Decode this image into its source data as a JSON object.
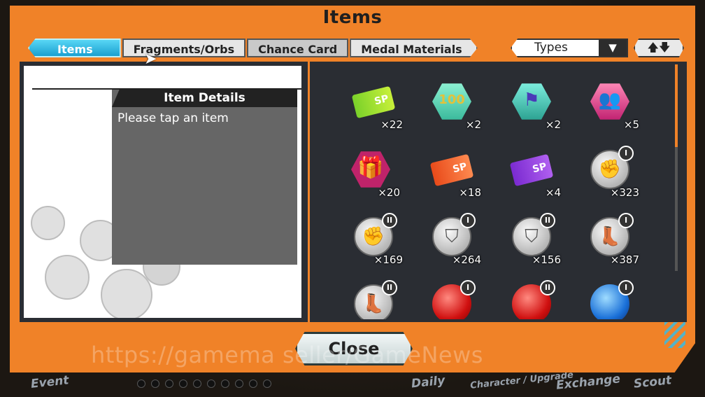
{
  "window": {
    "title": "Items"
  },
  "tabs": [
    {
      "label": "Items",
      "active": true
    },
    {
      "label": "Fragments/Orbs",
      "active": false
    },
    {
      "label": "Chance Card",
      "active": false
    },
    {
      "label": "Medal Materials",
      "active": false
    }
  ],
  "filter": {
    "types_label": "Types",
    "sort_icons": "🡅🡇"
  },
  "details": {
    "header": "Item Details",
    "placeholder": "Please tap an item"
  },
  "items": [
    {
      "icon": "sp-ticket-green-icon",
      "count": "×22",
      "sp": "SP"
    },
    {
      "icon": "hex-badge-100-icon",
      "count": "×2",
      "label": "100"
    },
    {
      "icon": "hex-badge-flag-icon",
      "count": "×2"
    },
    {
      "icon": "hex-badge-people-icon",
      "count": "×5"
    },
    {
      "icon": "gift-box-icon",
      "count": "×20"
    },
    {
      "icon": "sp-ticket-red-icon",
      "count": "×18",
      "sp": "SP"
    },
    {
      "icon": "sp-ticket-purple-icon",
      "count": "×4",
      "sp": "SP"
    },
    {
      "icon": "fist-medal-icon",
      "count": "×323",
      "rank": "I"
    },
    {
      "icon": "fist-medal-icon",
      "count": "×169",
      "rank": "II"
    },
    {
      "icon": "shield-medal-icon",
      "count": "×264",
      "rank": "I"
    },
    {
      "icon": "shield-medal-icon",
      "count": "×156",
      "rank": "II"
    },
    {
      "icon": "boot-medal-icon",
      "count": "×387",
      "rank": "I"
    },
    {
      "icon": "boot-medal-icon",
      "count": "",
      "rank": "II"
    },
    {
      "icon": "red-orb-icon",
      "count": "",
      "rank": "I"
    },
    {
      "icon": "red-orb-icon",
      "count": "",
      "rank": "II"
    },
    {
      "icon": "blue-orb-icon",
      "count": "",
      "rank": "I"
    }
  ],
  "close_button": {
    "label": "Close"
  },
  "watermark": "https://gamema    seller/GameNews",
  "bottom_nav": [
    "Event",
    "Daily",
    "Character / Upgrade",
    "Exchange",
    "Scout"
  ],
  "colors": {
    "frame": "#f08228",
    "tab_active": "#1aa0d0",
    "panel": "#2a2d33"
  }
}
